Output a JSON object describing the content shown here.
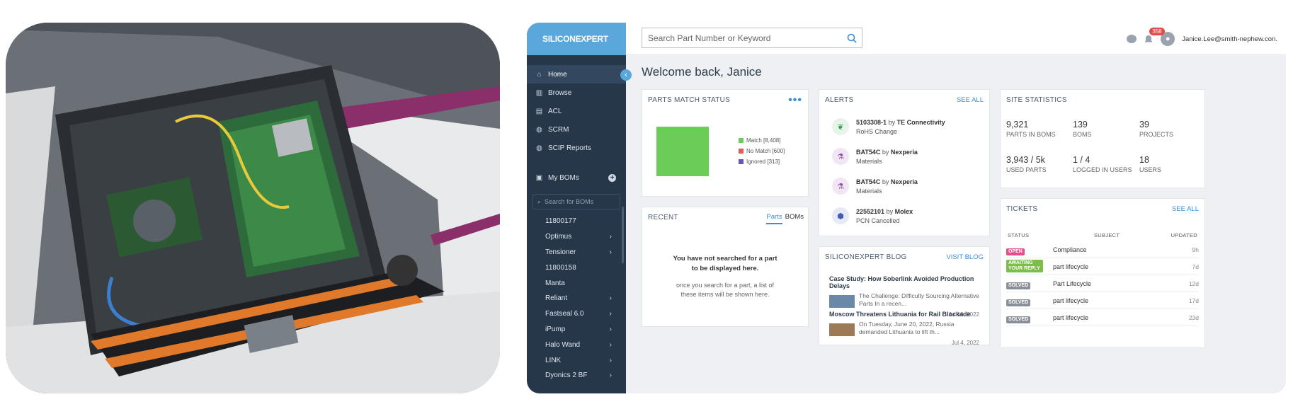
{
  "colors": {
    "sidebar": "#26374a",
    "brand": "#5aa7dc",
    "match": "#6ccc58",
    "no_match": "#e05b5b",
    "ignored": "#6a54b8",
    "open": "#e84c8a",
    "awaiting": "#7bbf4a",
    "solved": "#8b9097"
  },
  "brand": {
    "logo": "SILICONEXPERT"
  },
  "sidebar": {
    "items": [
      {
        "label": "Home",
        "icon": "home-icon"
      },
      {
        "label": "Browse",
        "icon": "book-icon"
      },
      {
        "label": "ACL",
        "icon": "clipboard-icon"
      },
      {
        "label": "SCRM",
        "icon": "globe-icon"
      },
      {
        "label": "SCIP Reports",
        "icon": "globe-icon"
      }
    ],
    "my_boms": "My BOMs",
    "bom_search_placeholder": "Search for BOMs",
    "boms": [
      {
        "label": "11800177",
        "chev": ""
      },
      {
        "label": "Optimus",
        "chev": "›"
      },
      {
        "label": "Tensioner",
        "chev": "›"
      },
      {
        "label": "11800158",
        "chev": ""
      },
      {
        "label": "Manta",
        "chev": ""
      },
      {
        "label": "Reliant",
        "chev": "›"
      },
      {
        "label": "Fastseal 6.0",
        "chev": "›"
      },
      {
        "label": "iPump",
        "chev": "›"
      },
      {
        "label": "Halo Wand",
        "chev": "›"
      },
      {
        "label": "LINK",
        "chev": "›"
      },
      {
        "label": "Dyonics 2 BF",
        "chev": "›"
      }
    ]
  },
  "header": {
    "search_placeholder": "Search Part Number or Keyword",
    "notifications": "358",
    "user_email": "Janice.Lee@smith-nephew.con."
  },
  "welcome": "Welcome back, Janice",
  "parts_match": {
    "title": "PARTS MATCH STATUS",
    "legend": [
      "Match [8,408]",
      "No Match [600]",
      "Ignored [313]"
    ]
  },
  "alerts": {
    "title": "ALERTS",
    "see_all": "SEE ALL",
    "items": [
      {
        "part": "5103308-1",
        "by": "by",
        "maker": "TE Connectivity",
        "type": "RoHS Change"
      },
      {
        "part": "BAT54C",
        "by": "by",
        "maker": "Nexperia",
        "type": "Materials"
      },
      {
        "part": "BAT54C",
        "by": "by",
        "maker": "Nexperia",
        "type": "Materials"
      },
      {
        "part": "22552101",
        "by": "by",
        "maker": "Molex",
        "type": "PCN Cancelled"
      }
    ]
  },
  "site_stats": {
    "title": "SITE STATISTICS",
    "items": [
      {
        "value": "9,321",
        "label": "PARTS IN BOMS"
      },
      {
        "value": "139",
        "label": "BOMS"
      },
      {
        "value": "39",
        "label": "PROJECTS"
      },
      {
        "value": "3,943 / 5k",
        "label": "USED PARTS"
      },
      {
        "value": "1 / 4",
        "label": "LOGGED IN USERS"
      },
      {
        "value": "18",
        "label": "USERS"
      }
    ]
  },
  "recent": {
    "title": "RECENT",
    "tab_parts": "Parts",
    "tab_boms": "BOMs",
    "message": "You have not searched for a part to be displayed here.",
    "sub": "once you search for a part, a list of these items will be shown here."
  },
  "blog": {
    "title": "SILICONEXPERT BLOG",
    "link": "VISIT BLOG",
    "items": [
      {
        "title": "Case Study: How Soberlink Avoided Production Delays",
        "snippet": "The Challenge: Difficulty Sourcing Alternative Parts In a recen...",
        "date": "Jul 19, 2022"
      },
      {
        "title": "Moscow Threatens Lithuania for Rail Blockade",
        "snippet": "On Tuesday, June 20, 2022, Russia demanded Lithuania to lift th...",
        "date": "Jul 4, 2022"
      }
    ]
  },
  "tickets": {
    "title": "TICKETS",
    "see_all": "SEE ALL",
    "col_status": "STATUS",
    "col_subject": "SUBJECT",
    "col_updated": "UPDATED",
    "rows": [
      {
        "status": "OPEN",
        "subject": "Compliance",
        "updated": "9h"
      },
      {
        "status": "AWAITING YOUR REPLY",
        "subject": "part lifecycle",
        "updated": "7d"
      },
      {
        "status": "SOLVED",
        "subject": "Part Lifecycle",
        "updated": "12d"
      },
      {
        "status": "SOLVED",
        "subject": "part lifecycle",
        "updated": "17d"
      },
      {
        "status": "SOLVED",
        "subject": "part lifecycle",
        "updated": "23d"
      }
    ]
  }
}
